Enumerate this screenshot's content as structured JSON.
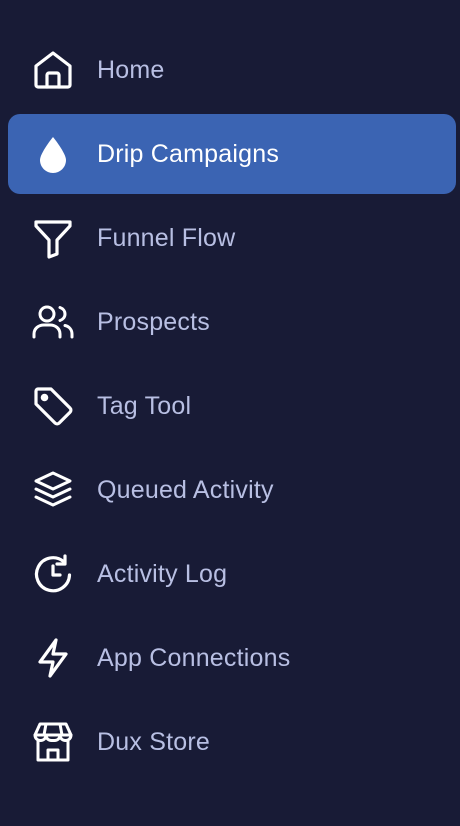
{
  "sidebar": {
    "active_index": 1,
    "items": [
      {
        "label": "Home",
        "icon": "home-icon"
      },
      {
        "label": "Drip Campaigns",
        "icon": "drop-icon"
      },
      {
        "label": "Funnel Flow",
        "icon": "funnel-icon"
      },
      {
        "label": "Prospects",
        "icon": "users-icon"
      },
      {
        "label": "Tag Tool",
        "icon": "tag-icon"
      },
      {
        "label": "Queued Activity",
        "icon": "layers-icon"
      },
      {
        "label": "Activity Log",
        "icon": "clock-rotate-icon"
      },
      {
        "label": "App Connections",
        "icon": "lightning-icon"
      },
      {
        "label": "Dux Store",
        "icon": "store-icon"
      }
    ]
  },
  "colors": {
    "background": "#181b36",
    "active_background": "#3b64b3",
    "label": "#b8bfe3",
    "active_label": "#ffffff"
  }
}
